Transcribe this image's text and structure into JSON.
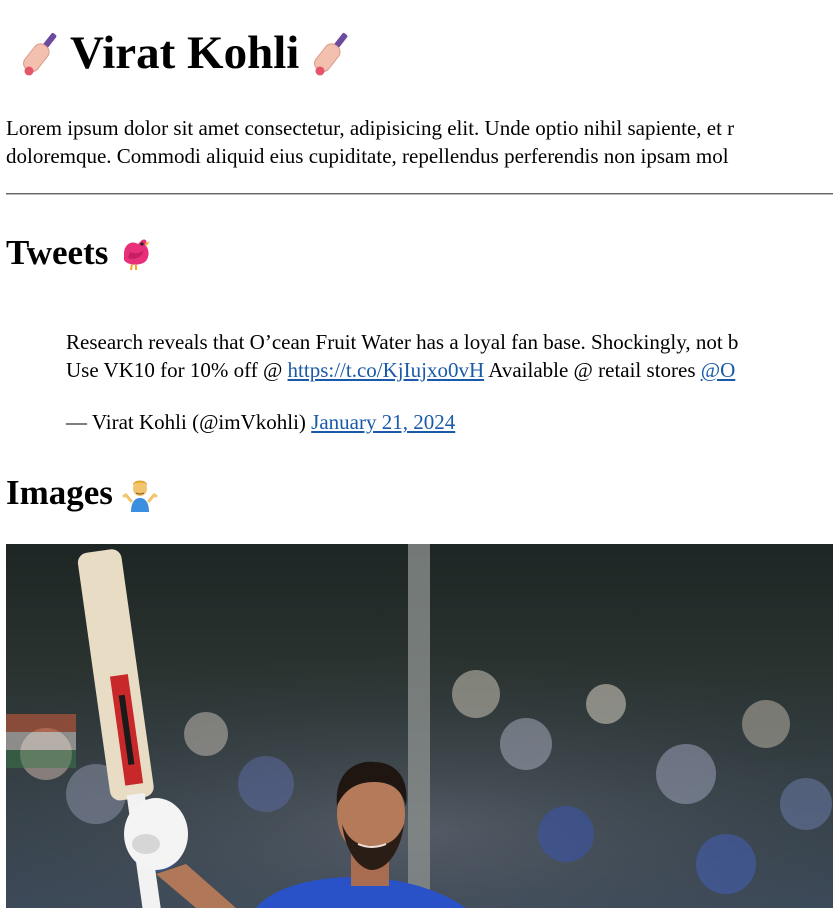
{
  "page": {
    "title": "Virat Kohli",
    "title_icon": "cricket-bat-icon",
    "intro_line1": "Lorem ipsum dolor sit amet consectetur, adipisicing elit. Unde optio nihil sapiente, et r",
    "intro_line2": "doloremque. Commodi aliquid eius cupiditate, repellendus perferendis non ipsam mol"
  },
  "tweets_section": {
    "heading": "Tweets",
    "icon": "bird-icon",
    "tweet": {
      "line1": "Research reveals that O’cean Fruit Water has a loyal fan base. Shockingly, not b",
      "line2_before_link": "Use VK10 for 10% off @ ",
      "link1": "https://t.co/KjIujxo0vH",
      "line2_middle": " Available @ retail stores ",
      "link2": "@O",
      "sig_prefix": "— Virat Kohli (@imVkohli) ",
      "date_link": "January 21, 2024"
    }
  },
  "images_section": {
    "heading": "Images",
    "icon": "person-shrugging-icon"
  },
  "colors": {
    "link": "#1a5aa8",
    "rule": "#666666"
  }
}
